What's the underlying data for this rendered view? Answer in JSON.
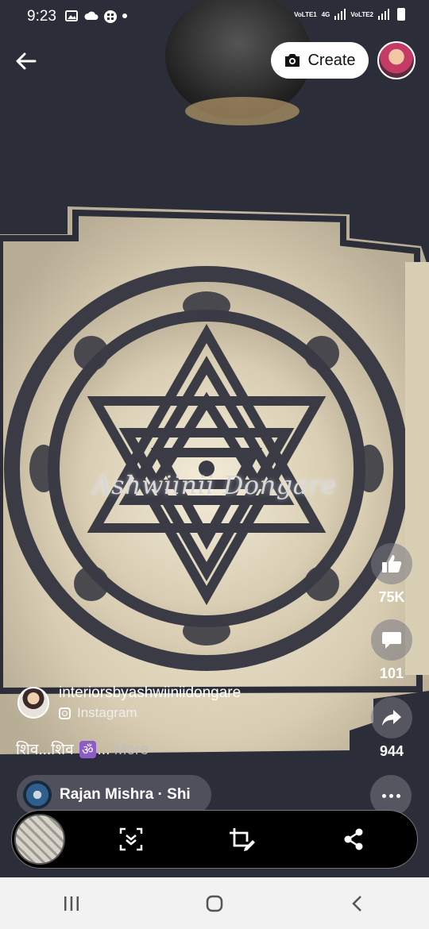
{
  "status": {
    "time": "9:23",
    "network1": "VoLTE1",
    "network_type": "4G",
    "network2": "VoLTE2"
  },
  "header": {
    "create_label": "Create"
  },
  "video": {
    "watermark": "Ashwiinii Dongare"
  },
  "actions": {
    "likes": "75K",
    "comments": "101",
    "shares": "944"
  },
  "author": {
    "name": "interiorsbyashwiiniidongare",
    "source": "Instagram"
  },
  "caption": {
    "text": "शिव...शिव",
    "emoji": "ॐ",
    "ellipsis": "...",
    "more": "More"
  },
  "audio": {
    "label": "Rajan Mishra · Shi"
  },
  "colors": {
    "background": "#2a2c36",
    "panel": "#e9e2cf",
    "button_bg": "#ffffff",
    "nav_bg": "#f2f2f2"
  }
}
